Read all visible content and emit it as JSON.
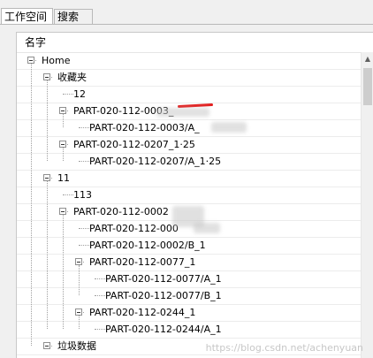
{
  "tabs": [
    {
      "label": "工作空间",
      "active": true
    },
    {
      "label": "搜索",
      "active": false
    }
  ],
  "column_header": "名字",
  "tree": [
    {
      "label": "Home",
      "level": 0,
      "expanded": true
    },
    {
      "label": "收藏夹",
      "level": 1,
      "expanded": true
    },
    {
      "label": "12",
      "level": 2
    },
    {
      "label": "PART-020-112-0003_",
      "level": 2,
      "expanded": true,
      "annotation": "red-underline"
    },
    {
      "label": "PART-020-112-0003/A_",
      "level": 3,
      "redacted": true
    },
    {
      "label": "PART-020-112-0207_1·25",
      "level": 2,
      "expanded": true
    },
    {
      "label": "PART-020-112-0207/A_1·25",
      "level": 3
    },
    {
      "label": "11",
      "level": 1,
      "expanded": true
    },
    {
      "label": "113",
      "level": 2
    },
    {
      "label": "PART-020-112-0002",
      "level": 2,
      "expanded": true,
      "redacted": true
    },
    {
      "label": "PART-020-112-000",
      "level": 3,
      "redacted": true
    },
    {
      "label": "PART-020-112-0002/B_1",
      "level": 3
    },
    {
      "label": "PART-020-112-0077_1",
      "level": 3,
      "expanded": true
    },
    {
      "label": "PART-020-112-0077/A_1",
      "level": 4
    },
    {
      "label": "PART-020-112-0077/B_1",
      "level": 4
    },
    {
      "label": "PART-020-112-0244_1",
      "level": 3,
      "expanded": true
    },
    {
      "label": "PART-020-112-0244/A_1",
      "level": 4
    },
    {
      "label": "垃圾数据",
      "level": 1,
      "expanded": true
    }
  ],
  "watermark": "https://blog.csdn.net/achenyuan",
  "colors": {
    "redline": "#e21f1f",
    "panel_bg": "#ffffff",
    "chrome_bg": "#f0f0f0"
  }
}
